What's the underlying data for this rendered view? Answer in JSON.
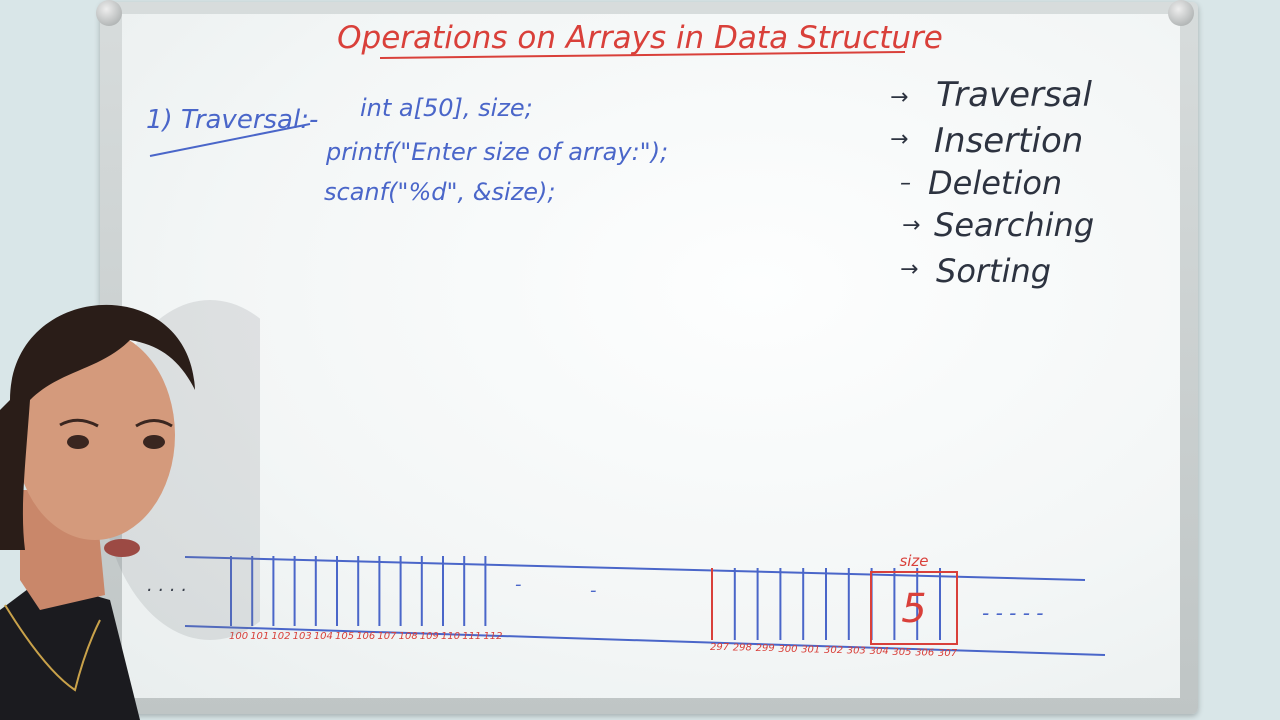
{
  "title": "Operations on Arrays in Data Structure",
  "section_heading": "1) Traversal:-",
  "code_lines": [
    "int a[50], size;",
    "printf(\"Enter size of array:\");",
    "scanf(\"%d\", &size);"
  ],
  "operations": [
    "Traversal",
    "Insertion",
    "Deletion",
    "Searching",
    "Sorting"
  ],
  "array_left_addresses": [
    "100",
    "101",
    "102",
    "103",
    "104",
    "105",
    "106",
    "107",
    "108",
    "109",
    "110",
    "111",
    "112"
  ],
  "array_right_addresses": [
    "297",
    "298",
    "299",
    "300",
    "301",
    "302",
    "303",
    "304",
    "305",
    "306",
    "307"
  ],
  "size_label": "size",
  "size_value": "5",
  "colors": {
    "red_marker": "#d9403a",
    "blue_marker": "#4a66c9",
    "black_marker": "#2d3340"
  }
}
